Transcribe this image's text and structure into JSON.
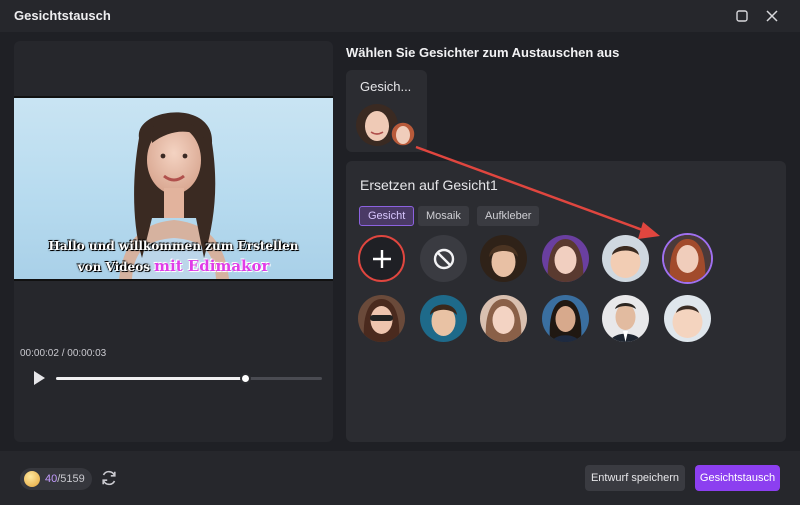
{
  "window": {
    "title": "Gesichtstausch"
  },
  "player": {
    "subtitle_line1": "Hallo und willkommen zum Erstellen",
    "subtitle_line2_start": "von Videos ",
    "subtitle_line2_highlight": "mit Edimakor",
    "current_time": "00:00:02",
    "total_time": "00:00:03",
    "time_separator": " / ",
    "progress": 0.71
  },
  "faces_section": {
    "heading": "Wählen Sie Gesichter zum Austauschen aus",
    "card_label": "Gesich..."
  },
  "replace": {
    "title": "Ersetzen auf Gesicht1",
    "tabs": [
      "Gesicht",
      "Mosaik",
      "Aufkleber"
    ],
    "active_tab": "Gesicht",
    "add_icon": "plus-icon",
    "none_icon": "prohibited-icon"
  },
  "footer": {
    "credits_used": "40",
    "credits_total": "/5159",
    "save_draft": "Entwurf speichern",
    "swap": "Gesichtstausch"
  },
  "colors": {
    "accent": "#8c3ff0",
    "highlight_red": "#e0463f",
    "subtitle_pink": "#e03ce8"
  }
}
